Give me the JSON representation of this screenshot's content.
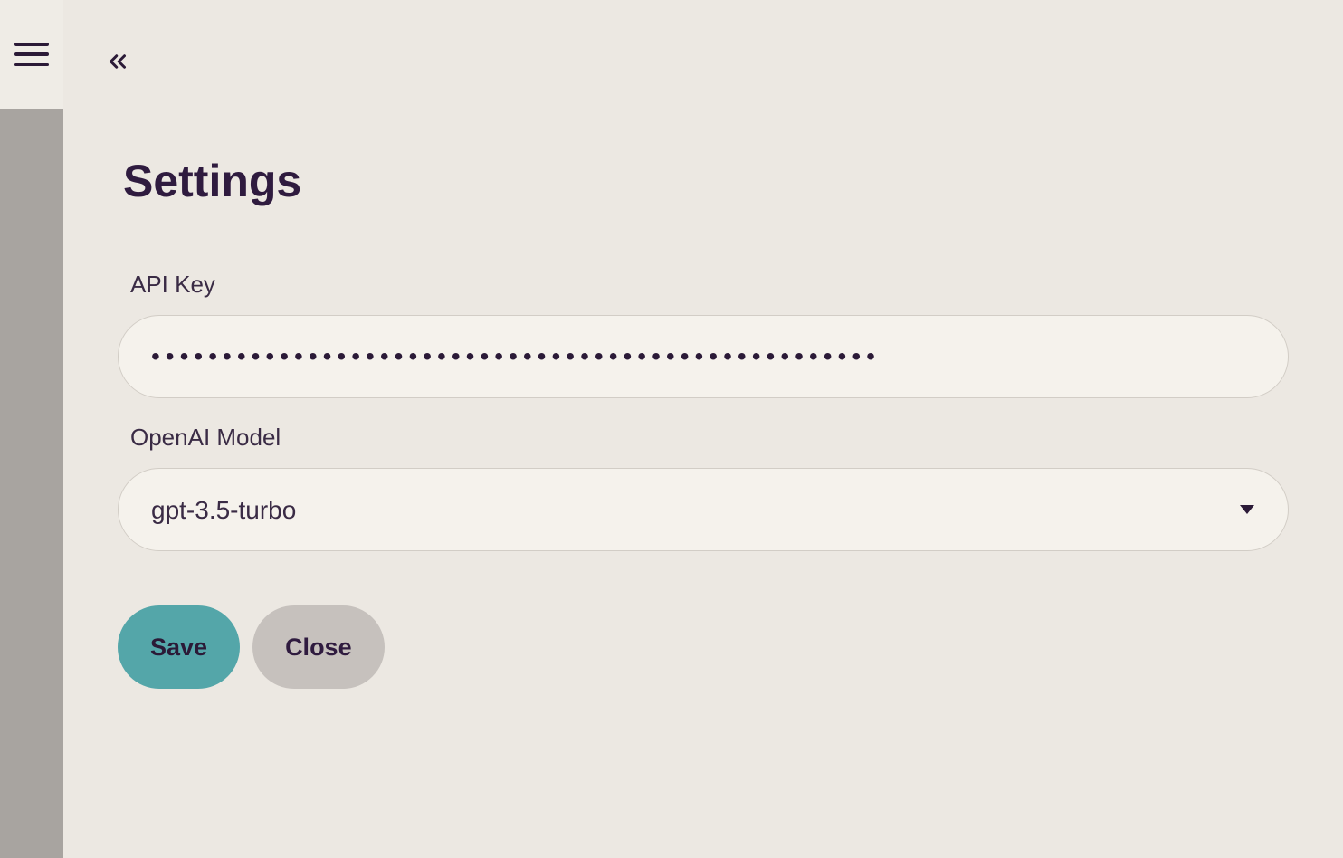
{
  "page": {
    "title": "Settings"
  },
  "fields": {
    "api_key": {
      "label": "API Key",
      "value": "•••••••••••••••••••••••••••••••••••••••••••••••••••"
    },
    "model": {
      "label": "OpenAI Model",
      "selected": "gpt-3.5-turbo"
    }
  },
  "buttons": {
    "save": "Save",
    "close": "Close"
  }
}
